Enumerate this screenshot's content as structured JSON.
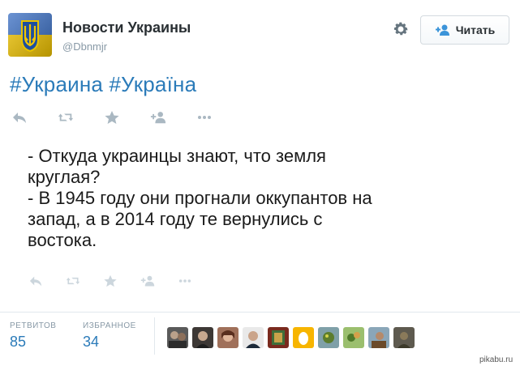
{
  "account": {
    "name": "Новости Украины",
    "handle": "@Dbnmjr",
    "avatar_icon": "ukraine-coat-of-arms-icon"
  },
  "header": {
    "settings_icon": "gear-icon",
    "follow_icon": "add-user-icon",
    "follow_label": "Читать"
  },
  "tweet": {
    "hashtags": [
      "#Украина",
      "#Україна"
    ],
    "lines": [
      "- Откуда украинцы знают, что земля",
      "круглая?",
      "- В 1945 году они прогнали оккупантов на",
      "запад, а в 2014 году те вернулись с",
      "востока."
    ]
  },
  "actions": [
    "reply-icon",
    "retweet-icon",
    "favorite-icon",
    "follow-icon",
    "more-icon"
  ],
  "stats": {
    "retweets_label": "РЕТВИТОВ",
    "retweets_value": "85",
    "favorites_label": "ИЗБРАННОЕ",
    "favorites_value": "34"
  },
  "watermark": "pikabu.ru",
  "colors": {
    "link": "#2b7bb9",
    "muted": "#8899a6",
    "icon": "#aab8c2"
  }
}
